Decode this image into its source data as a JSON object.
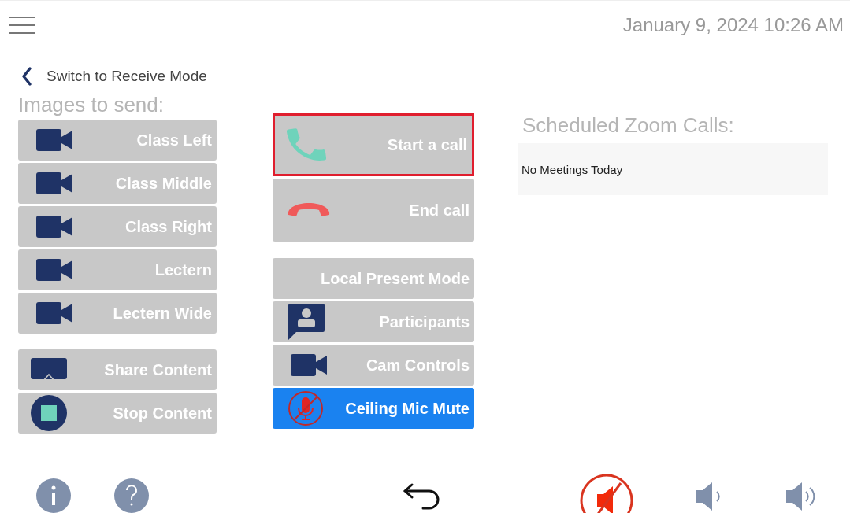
{
  "header": {
    "datetime": "January 9, 2024 10:26 AM"
  },
  "back_link": {
    "label": "Switch to Receive Mode"
  },
  "images_to_send": {
    "title": "Images to send:",
    "sources": [
      {
        "label": "Class Left",
        "kind": "camera"
      },
      {
        "label": "Class Middle",
        "kind": "camera"
      },
      {
        "label": "Class Right",
        "kind": "camera"
      },
      {
        "label": "Lectern",
        "kind": "camera"
      },
      {
        "label": "Lectern Wide",
        "kind": "camera"
      }
    ],
    "content": [
      {
        "label": "Share Content",
        "kind": "share"
      },
      {
        "label": "Stop Content",
        "kind": "stop"
      }
    ]
  },
  "call_buttons": [
    {
      "label": "Start a call",
      "kind": "phone",
      "highlighted": true
    },
    {
      "label": "End call",
      "kind": "hangup",
      "highlighted": false
    }
  ],
  "mode_buttons": [
    {
      "label": "Local Present Mode",
      "kind": "none",
      "active": false
    },
    {
      "label": "Participants",
      "kind": "person",
      "active": false
    },
    {
      "label": "Cam Controls",
      "kind": "camera",
      "active": false
    },
    {
      "label": "Ceiling Mic Mute",
      "kind": "mic-off",
      "active": true
    }
  ],
  "scheduled_calls": {
    "title": "Scheduled Zoom Calls:",
    "message": "No Meetings Today"
  },
  "audio": {
    "muted": true
  }
}
